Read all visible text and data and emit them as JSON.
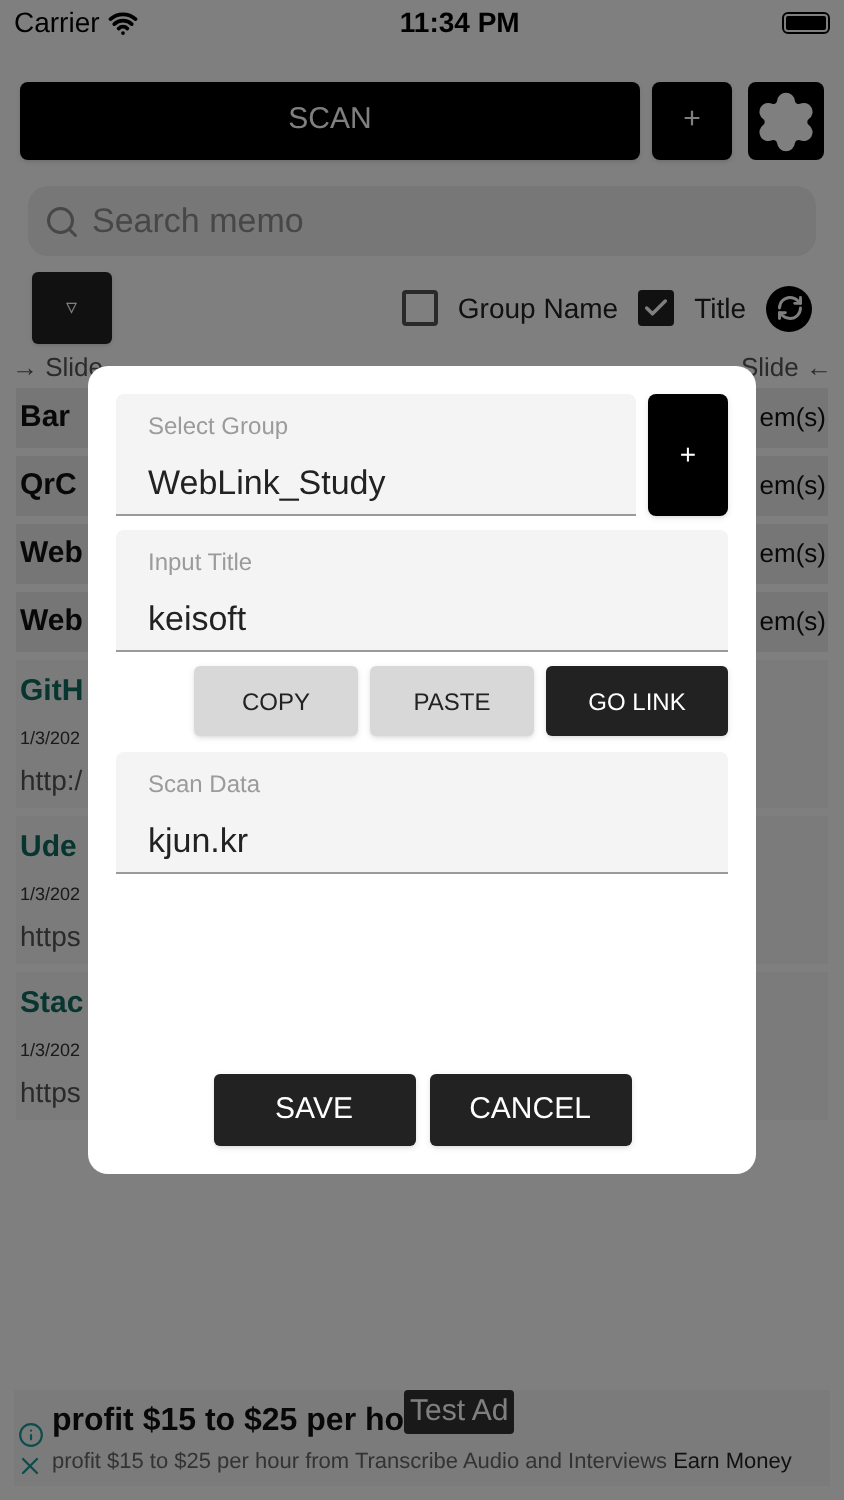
{
  "status_bar": {
    "carrier": "Carrier",
    "time": "11:34 PM"
  },
  "toolbar": {
    "scan_button": "SCAN",
    "add_button": "+"
  },
  "search": {
    "placeholder": "Search memo"
  },
  "filter": {
    "dropdown": "▿",
    "options": [
      {
        "label": "Group Name",
        "checked": false
      },
      {
        "label": "Title",
        "checked": true
      }
    ]
  },
  "hints": {
    "left": "→ Slide",
    "right": "Slide ←"
  },
  "groups": [
    {
      "name": "Bar",
      "count": "em(s)"
    },
    {
      "name": "QrC",
      "count": "em(s)"
    },
    {
      "name": "Web",
      "count": "em(s)"
    },
    {
      "name": "Web",
      "count": "em(s)"
    }
  ],
  "memos": [
    {
      "title": "GitH",
      "date": "1/3/202",
      "url": "http:/"
    },
    {
      "title": "Ude",
      "date": "1/3/202",
      "url": "https"
    },
    {
      "title": "Stac",
      "date": "1/3/202",
      "url": "https"
    }
  ],
  "dialog": {
    "fields": [
      {
        "label": "Select Group",
        "value": "WebLink_Study"
      },
      {
        "label": "Input Title",
        "value": "keisoft"
      },
      {
        "label": "Scan Data",
        "value": "kjun.kr"
      }
    ],
    "group_add": "+",
    "actions": [
      {
        "label": "COPY",
        "kind": "light"
      },
      {
        "label": "PASTE",
        "kind": "light"
      },
      {
        "label": "GO LINK",
        "kind": "dark"
      }
    ],
    "buttons": [
      "SAVE",
      "CANCEL"
    ]
  },
  "ad": {
    "badge": "Test Ad",
    "headline": "profit $15 to $25 per ho",
    "body": "profit $15 to $25 per hour from Transcribe Audio and Interviews",
    "cta": "Earn Money"
  }
}
